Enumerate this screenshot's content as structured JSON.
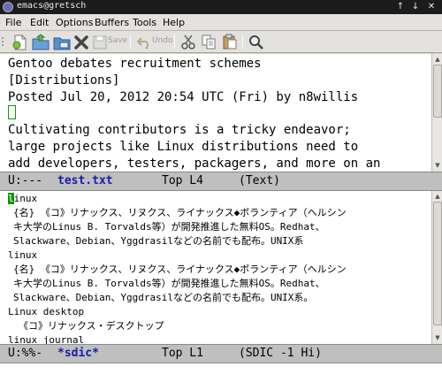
{
  "window": {
    "title": "emacs@gretsch",
    "buttons": [
      "↑",
      "↓",
      "✕"
    ]
  },
  "menubar": {
    "items": [
      "File",
      "Edit",
      "Options",
      "Buffers",
      "Tools",
      "Help"
    ]
  },
  "toolbar": {
    "save_label": "Save",
    "undo_label": "Undo"
  },
  "top_buffer": {
    "lines": [
      "Gentoo debates recruitment schemes",
      "[Distributions]",
      "Posted Jul 20, 2012 20:54 UTC (Fri) by n8willis",
      "",
      "Cultivating contributors is a tricky endeavor;",
      "large projects like Linux distributions need to",
      "add developers, testers, packagers, and more on an"
    ]
  },
  "top_modeline": {
    "status": "U:---",
    "buffer_name": "test.txt",
    "position": "Top L4",
    "mode": "(Text)"
  },
  "bottom_buffer": {
    "cursor_char": "l",
    "first_line_rest": "inux",
    "lines": [
      "{名} 《コ》リナックス、リヌクス、ライナックス◆ボランティア（ヘルシン",
      "キ大学のLinus B. Torvalds等）が開発推進した無料OS。Redhat、",
      "Slackware、Debian、Yggdrasilなどの名前でも配布。UNIX系",
      "linux",
      "{名} 《コ》リナックス、リヌクス、ライナックス◆ボランティア（ヘルシン",
      "キ大学のLinus B. Torvalds等）が開発推進した無料OS。Redhat、",
      "Slackware、Debian、Yggdrasilなどの名前でも配布。UNIX系。",
      "Linux desktop",
      "《コ》リナックス・デスクトップ",
      "linux journal"
    ]
  },
  "bottom_modeline": {
    "status": "U:%%-",
    "buffer_name": "*sdic*",
    "position": "Top L1",
    "mode": "(SDIC -1 Hi)"
  },
  "colors": {
    "cursor": "#0a9a0a",
    "modeline_bg": "#bfbfbf",
    "buffer_name": "#1a1aa8"
  }
}
